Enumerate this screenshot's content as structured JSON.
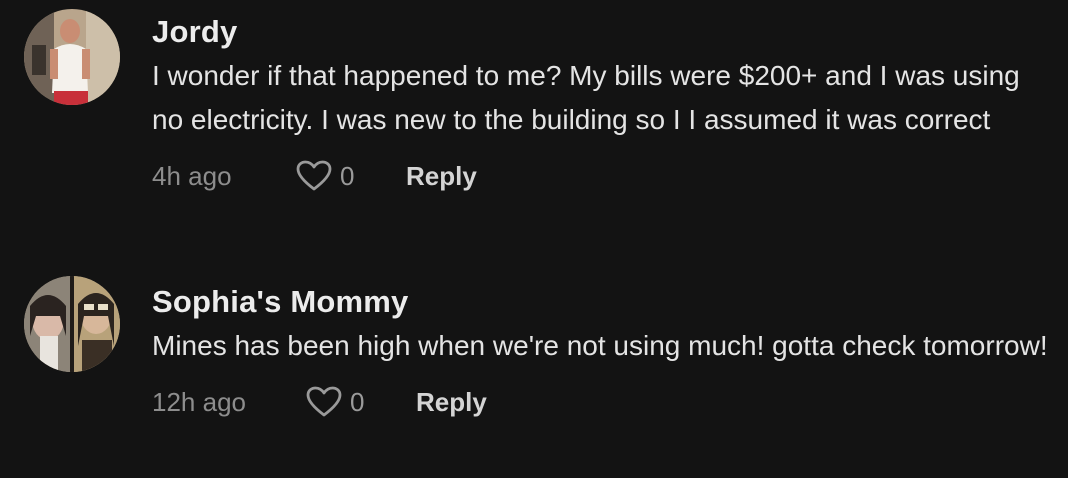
{
  "comments": [
    {
      "username": "Jordy",
      "text": "I wonder if that happened to me? My bills were $200+ and I was using no electricity. I was new to the building so I I assumed it was correct",
      "time": "4h ago",
      "likes": "0",
      "reply_label": "Reply",
      "avatar_icon": "user-avatar-photo"
    },
    {
      "username": "Sophia's Mommy",
      "text": "Mines has been high when we're not using much! gotta check tomorrow!",
      "time": "12h ago",
      "likes": "0",
      "reply_label": "Reply",
      "avatar_icon": "user-avatar-photo"
    }
  ],
  "icons": {
    "like": "heart-outline-icon"
  },
  "colors": {
    "background": "#131313",
    "username": "#ececec",
    "text": "#e4e4e4",
    "muted": "#8d8d8d"
  }
}
